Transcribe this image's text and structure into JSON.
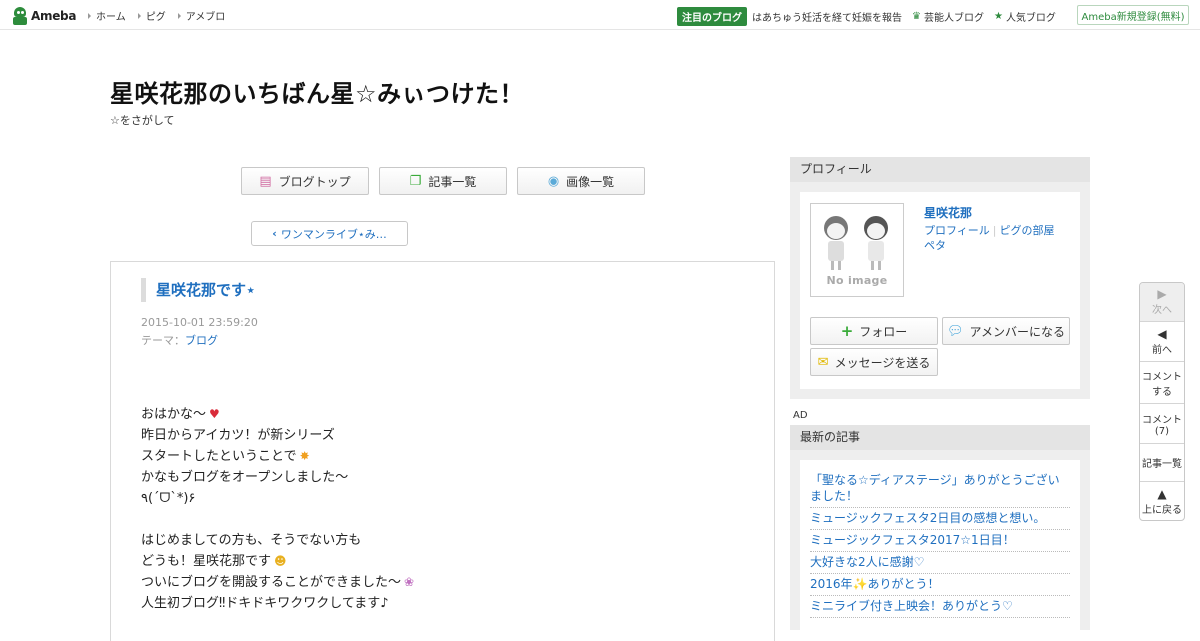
{
  "topbar": {
    "logo_text": "Ameba",
    "nav": [
      "ホーム",
      "ピグ",
      "アメブロ"
    ],
    "featured_badge": "注目のブログ",
    "featured_headline": "はあちゅう妊活を経て妊娠を報告",
    "celeb_blog": "芸能人ブログ",
    "popular_blog": "人気ブログ",
    "signup": "Ameba新規登録(無料)"
  },
  "blog": {
    "title": "星咲花那のいちばん星☆みぃつけた！",
    "description": "☆をさがして"
  },
  "main_nav": {
    "blog_top": "ブログトップ",
    "article_list": "記事一覧",
    "image_list": "画像一覧",
    "prev_entry": "ワンマンライブ⋆み…"
  },
  "article": {
    "title": "星咲花那です⋆",
    "date": "2015-10-01 23:59:20",
    "theme_label": "テーマ：",
    "theme": "ブログ",
    "lines": [
      "おはかな～",
      "昨日からアイカツ！が新シリーズ",
      "スタートしたということで",
      "かなもブログをオープンしました～",
      "٩(´ᗜ`*)۶",
      "",
      "はじめましての方も、そうでない方も",
      "どうも！星咲花那です",
      "ついにブログを開設することができました～",
      "人生初ブログ‼ドキドキワクワクしてます♪"
    ]
  },
  "profile": {
    "header": "プロフィール",
    "no_image": "No image",
    "name": "星咲花那",
    "link_profile": "プロフィール",
    "link_pig_room": "ピグの部屋",
    "link_peta": "ペタ",
    "follow": "フォロー",
    "amember": "アメンバーになる",
    "message": "メッセージを送る"
  },
  "ad_label": "AD",
  "recent": {
    "header": "最新の記事",
    "items": [
      "「聖なる☆ディアステージ」ありがとうございました！",
      "ミュージックフェスタ2日目の感想と想い。",
      "ミュージックフェスタ2017☆1日目！",
      "大好きな2人に感謝♡",
      "2016年✨ありがとう！",
      "ミニライブ付き上映会！ありがとう♡"
    ]
  },
  "floatnav": {
    "next": "次へ",
    "prev": "前へ",
    "comment_line1": "コメント",
    "comment_line2": "する",
    "comments_line1": "コメント",
    "comments_line2": "(7)",
    "list": "記事一覧",
    "up": "上に戻る"
  },
  "colors": {
    "accent_green": "#2e8b3e",
    "link_blue": "#1f6fbf"
  }
}
